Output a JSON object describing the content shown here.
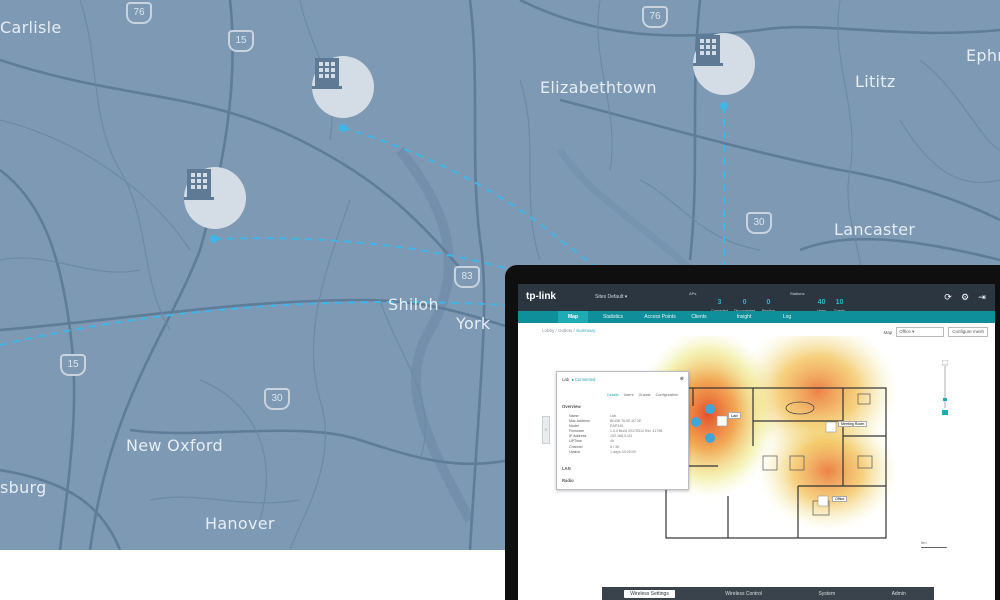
{
  "map": {
    "places": [
      "Carlisle",
      "Elizabethtown",
      "Lititz",
      "Ephr",
      "Lancaster",
      "Shiloh",
      "York",
      "New Oxford",
      "sburg",
      "Hanover"
    ],
    "route_shields": [
      "15",
      "76",
      "76",
      "30",
      "83",
      "15",
      "30"
    ],
    "building_icon": "building-icon",
    "link_color": "#3fb6e8"
  },
  "app": {
    "logo": "tp-link",
    "site": "Sites Default",
    "stats": [
      {
        "label": "APs",
        "values": [
          "3",
          "0",
          "0"
        ],
        "subs": [
          "Connected",
          "Disconnected",
          "Pending"
        ]
      },
      {
        "label": "Stations",
        "values": [
          "40",
          "10"
        ],
        "subs": [
          "Users",
          "Guests"
        ]
      }
    ],
    "nav": [
      "Map",
      "Statistics",
      "Access Points",
      "Clients",
      "Insight",
      "Log"
    ],
    "breadcrumb": {
      "items": [
        "Lobby",
        "Outlets"
      ],
      "current": "Summary"
    },
    "map_label": "Map",
    "map_select": "Office",
    "configure_button": "Configure mesh",
    "panel": {
      "name": "Lab",
      "status": "Connected",
      "tabs": [
        "Details",
        "Users",
        "Guests",
        "Configuration"
      ],
      "overview_title": "Overview",
      "fields": [
        "Name",
        "Mac Address",
        "Model",
        "Firmware",
        "IP Address",
        "UPTime",
        "Channel",
        "Uptime"
      ],
      "values": [
        "Lab",
        "B0:BE:76:0E:A7:2E",
        "EAP245",
        "1.0.0 Build 20170512 Rel. 41798",
        "192.168.0.111",
        "4h",
        "6 / 36",
        "1 days 03:25:09"
      ],
      "lan_title": "LAN",
      "radio_title": "Radio"
    },
    "ap_labels": [
      "Lab",
      "Meeting Room",
      "Office"
    ],
    "scale_label": "5m",
    "bottom_tabs": [
      "Wireless Settings",
      "Wireless Control",
      "System",
      "Admin"
    ],
    "colors": {
      "topbar": "#2c3640",
      "nav": "#0f8f99",
      "accent": "#20aab6"
    }
  }
}
